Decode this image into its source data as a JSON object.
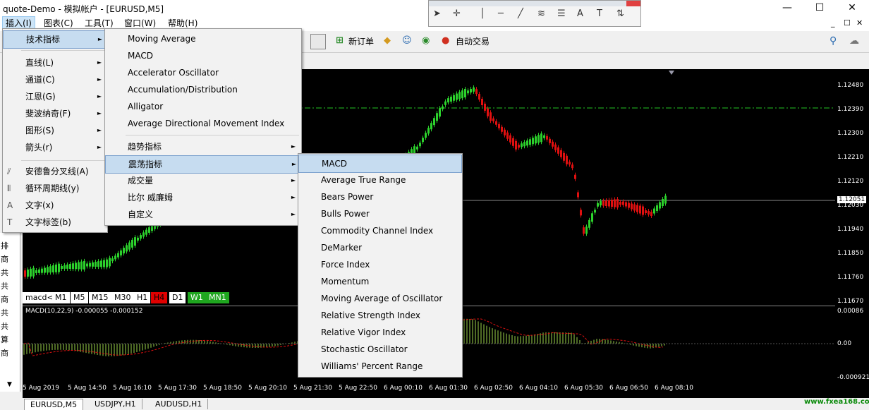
{
  "window": {
    "title": "quote-Demo - 模拟帐户 - [EURUSD,M5]",
    "min": "—",
    "max": "☐",
    "close": "✕"
  },
  "menubar": [
    "插入(I)",
    "图表(C)",
    "工具(T)",
    "窗口(W)",
    "帮助(H)"
  ],
  "mdi_controls": [
    "_",
    "☐",
    "✕"
  ],
  "toolbar": {
    "new_order": "新订单",
    "auto_trade": "自动交易"
  },
  "insert_menu": [
    {
      "label": "技术指标",
      "submenu": true
    },
    {
      "label": "直线(L)",
      "submenu": true
    },
    {
      "label": "通道(C)",
      "submenu": true
    },
    {
      "label": "江恩(G)",
      "submenu": true
    },
    {
      "label": "斐波纳奇(F)",
      "submenu": true
    },
    {
      "label": "图形(S)",
      "submenu": true
    },
    {
      "label": "箭头(r)",
      "submenu": true
    },
    {
      "label": "安德鲁分叉线(A)",
      "icon": "andrews-pitchfork-icon"
    },
    {
      "label": "循环周期线(y)",
      "icon": "cycle-lines-icon"
    },
    {
      "label": "文字(x)",
      "icon": "text-icon"
    },
    {
      "label": "文字标签(b)",
      "icon": "text-label-icon"
    }
  ],
  "indicators_menu": {
    "top": [
      "Moving Average",
      "MACD",
      "Accelerator Oscillator",
      "Accumulation/Distribution",
      "Alligator",
      "Average Directional Movement Index"
    ],
    "groups": [
      "趋势指标",
      "震荡指标",
      "成交量",
      "比尔 威廉姆",
      "自定义"
    ]
  },
  "oscillators_menu": [
    "MACD",
    "Average True Range",
    "Bears Power",
    "Bulls Power",
    "Commodity Channel Index",
    "DeMarker",
    "Force Index",
    "Momentum",
    "Moving Average of Oscillator",
    "Relative Strength Index",
    "Relative Vigor Index",
    "Stochastic Oscillator",
    "Williams' Percent Range"
  ],
  "chart": {
    "price_labels": [
      "1.12480",
      "1.12390",
      "1.12300",
      "1.12210",
      "1.12120",
      "1.12051",
      "1.12030",
      "1.11940",
      "1.11850",
      "1.11760",
      "1.11670"
    ],
    "current_price": "1.12051",
    "macd_info": "MACD(10,22,9) -0.000055 -0.000152",
    "macd_labels": [
      "0.00086",
      "0.00",
      "-0.000921"
    ],
    "time_labels": [
      "5 Aug 2019",
      "5 Aug 14:50",
      "5 Aug 16:10",
      "5 Aug 17:30",
      "5 Aug 18:50",
      "5 Aug 20:10",
      "5 Aug 21:30",
      "5 Aug 22:50",
      "6 Aug 00:10",
      "6 Aug 01:30",
      "6 Aug 02:50",
      "6 Aug 04:10",
      "6 Aug 05:30",
      "6 Aug 06:50",
      "6 Aug 08:10"
    ],
    "timeframes": [
      "macd<",
      "M1",
      "M5",
      "M15",
      "M30",
      "H1",
      "H4",
      "D1",
      "W1",
      "MN1"
    ]
  },
  "left_panel_chars": [
    "排",
    "商",
    "共",
    "共",
    "商",
    "共",
    "共",
    "算",
    "商"
  ],
  "tabs": [
    "EURUSD,M5",
    "USDJPY,H1",
    "AUDUSD,H1"
  ],
  "watermark": "www.fxea168.com",
  "colors": {
    "bull": "#2cd12c",
    "bear": "#e01010",
    "macd_hist": "#9bd34a",
    "signal": "#e01010",
    "level": "#25c525"
  }
}
